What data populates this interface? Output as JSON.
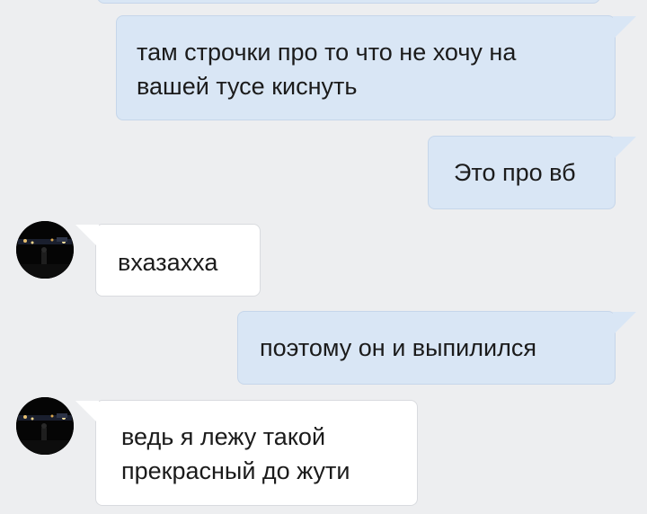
{
  "messages": [
    {
      "direction": "outgoing",
      "text": "там строчки про то что не хочу на\nвашей тусе киснуть"
    },
    {
      "direction": "outgoing",
      "text": "Это про вб"
    },
    {
      "direction": "incoming",
      "text": "вхазахха",
      "avatar_icon": "user-avatar-photo"
    },
    {
      "direction": "outgoing",
      "text": "поэтому он и выпилился"
    },
    {
      "direction": "incoming",
      "text": "ведь я лежу такой\nпрекрасный до жути",
      "avatar_icon": "user-avatar-photo"
    }
  ],
  "colors": {
    "background": "#edeef0",
    "outgoing_bubble": "#d9e6f5",
    "incoming_bubble": "#ffffff",
    "text": "#1b1b1b"
  }
}
